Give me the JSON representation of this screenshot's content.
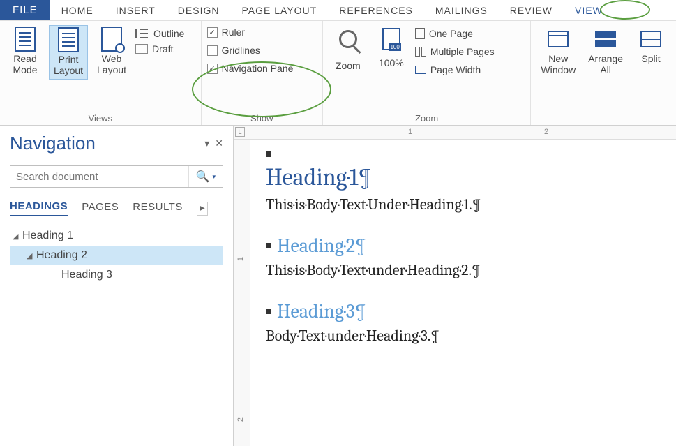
{
  "tabs": {
    "file": "FILE",
    "home": "HOME",
    "insert": "INSERT",
    "design": "DESIGN",
    "page_layout": "PAGE LAYOUT",
    "references": "REFERENCES",
    "mailings": "MAILINGS",
    "review": "REVIEW",
    "view": "VIEW"
  },
  "ribbon": {
    "views": {
      "read_mode": "Read\nMode",
      "print_layout": "Print\nLayout",
      "web_layout": "Web\nLayout",
      "outline": "Outline",
      "draft": "Draft",
      "group": "Views"
    },
    "show": {
      "ruler": "Ruler",
      "gridlines": "Gridlines",
      "nav_pane": "Navigation Pane",
      "group": "Show"
    },
    "zoom": {
      "zoom": "Zoom",
      "hundred": "100%",
      "one_page": "One Page",
      "multi_pages": "Multiple Pages",
      "page_width": "Page Width",
      "group": "Zoom"
    },
    "window": {
      "new_window": "New\nWindow",
      "arrange_all": "Arrange\nAll",
      "split": "Split"
    }
  },
  "nav": {
    "title": "Navigation",
    "search_placeholder": "Search document",
    "tabs": {
      "headings": "HEADINGS",
      "pages": "PAGES",
      "results": "RESULTS"
    },
    "tree": {
      "h1": "Heading 1",
      "h2": "Heading 2",
      "h3": "Heading 3"
    }
  },
  "ruler": {
    "corner": "L",
    "h1": "1",
    "h2": "2",
    "v1": "1",
    "v2": "2"
  },
  "doc": {
    "h1": "Heading·1¶",
    "b1": "This·is·Body·Text·Under·Heading·1.¶",
    "h2": "Heading·2¶",
    "b2": "This·is·Body·Text·under·Heading·2.¶",
    "h3": "Heading·3¶",
    "b3": "Body·Text·under·Heading·3.¶"
  }
}
